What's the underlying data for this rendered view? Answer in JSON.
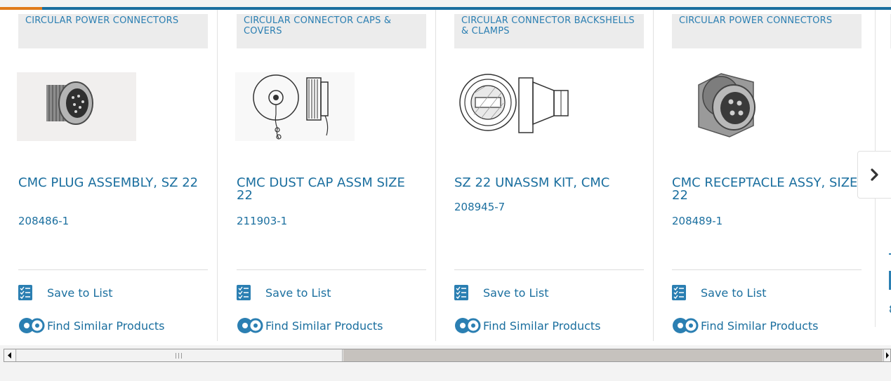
{
  "products": [
    {
      "category": "CIRCULAR POWER CONNECTORS",
      "title": "CMC PLUG ASSEMBLY, SZ 22",
      "part_number": "208486-1",
      "image": "plug-assembly-photo"
    },
    {
      "category": "CIRCULAR CONNECTOR CAPS & COVERS",
      "title": "CMC DUST CAP ASSM SIZE 22",
      "part_number": "211903-1",
      "image": "dust-cap-drawing"
    },
    {
      "category": "CIRCULAR CONNECTOR BACKSHELLS & CLAMPS",
      "title": "SZ 22 UNASSM KIT, CMC",
      "part_number": "208945-7",
      "image": "backshell-kit-drawing"
    },
    {
      "category": "CIRCULAR POWER CONNECTORS",
      "title": "CMC RECEPTACLE ASSY, SIZE 22",
      "part_number": "208489-1",
      "image": "receptacle-photo"
    }
  ],
  "actions": {
    "save_label": "Save to List",
    "similar_label": "Find Similar Products"
  },
  "peek": {
    "glyph": "8"
  },
  "colors": {
    "accent_blue": "#1b6f9f",
    "link_blue": "#2b7fb2",
    "accent_orange": "#e07b1b"
  },
  "icons": {
    "next": "chevron-right-icon",
    "save": "checklist-icon",
    "similar": "gears-icon",
    "scroll_left": "arrow-left-icon",
    "scroll_right": "arrow-right-icon"
  }
}
